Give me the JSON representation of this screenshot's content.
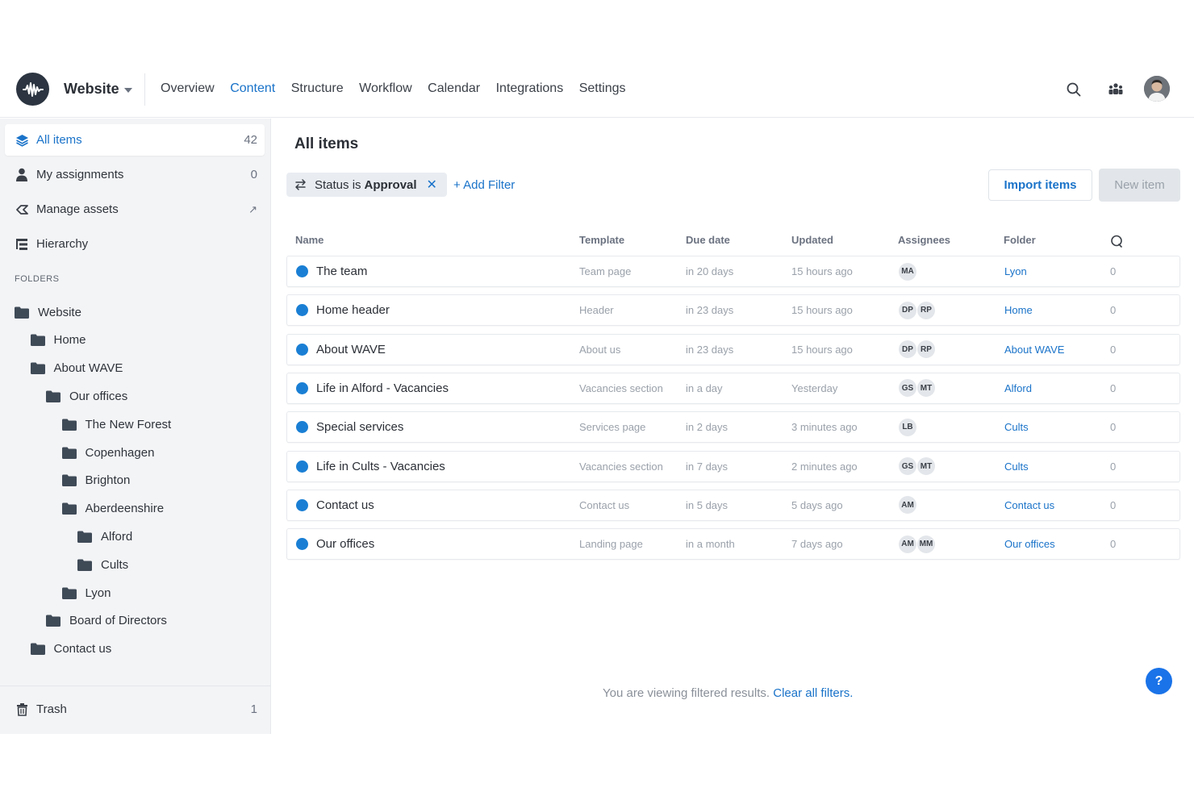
{
  "app": {
    "site_name": "Website",
    "nav": [
      "Overview",
      "Content",
      "Structure",
      "Workflow",
      "Calendar",
      "Integrations",
      "Settings"
    ],
    "active_nav": "Content"
  },
  "sidebar": {
    "items": [
      {
        "label": "All items",
        "count": "42",
        "icon": "layers-icon"
      },
      {
        "label": "My assignments",
        "count": "0",
        "icon": "user-icon"
      },
      {
        "label": "Manage assets",
        "count": "↗",
        "icon": "assets-icon"
      },
      {
        "label": "Hierarchy",
        "count": "",
        "icon": "hierarchy-icon"
      }
    ],
    "folders_label": "FOLDERS",
    "folders": [
      {
        "label": "Website",
        "level": 0
      },
      {
        "label": "Home",
        "level": 1
      },
      {
        "label": "About WAVE",
        "level": 1
      },
      {
        "label": "Our offices",
        "level": 2
      },
      {
        "label": "The New Forest",
        "level": 3
      },
      {
        "label": "Copenhagen",
        "level": 3
      },
      {
        "label": "Brighton",
        "level": 3
      },
      {
        "label": "Aberdeenshire",
        "level": 3
      },
      {
        "label": "Alford",
        "level": 4
      },
      {
        "label": "Cults",
        "level": 4
      },
      {
        "label": "Lyon",
        "level": 3
      },
      {
        "label": "Board of Directors",
        "level": 2
      },
      {
        "label": "Contact us",
        "level": 1
      }
    ],
    "trash": {
      "label": "Trash",
      "count": "1"
    }
  },
  "main": {
    "title": "All items",
    "filter": {
      "prefix": "Status is",
      "value": "Approval"
    },
    "add_filter": "+ Add Filter",
    "import_label": "Import items",
    "new_label": "New item",
    "columns": [
      "Name",
      "Template",
      "Due date",
      "Updated",
      "Assignees",
      "Folder"
    ],
    "rows": [
      {
        "name": "The team",
        "template": "Team page",
        "due": "in 20 days",
        "updated": "15 hours ago",
        "assignees": [
          "MA"
        ],
        "folder": "Lyon",
        "comments": "0"
      },
      {
        "name": "Home header",
        "template": "Header",
        "due": "in 23 days",
        "updated": "15 hours ago",
        "assignees": [
          "DP",
          "RP"
        ],
        "folder": "Home",
        "comments": "0"
      },
      {
        "name": "About WAVE",
        "template": "About us",
        "due": "in 23 days",
        "updated": "15 hours ago",
        "assignees": [
          "DP",
          "RP"
        ],
        "folder": "About WAVE",
        "comments": "0"
      },
      {
        "name": "Life in Alford - Vacancies",
        "template": "Vacancies section",
        "due": "in a day",
        "updated": "Yesterday",
        "assignees": [
          "GS",
          "MT"
        ],
        "folder": "Alford",
        "comments": "0"
      },
      {
        "name": "Special services",
        "template": "Services page",
        "due": "in 2 days",
        "updated": "3 minutes ago",
        "assignees": [
          "LB"
        ],
        "folder": "Cults",
        "comments": "0"
      },
      {
        "name": "Life in Cults - Vacancies",
        "template": "Vacancies section",
        "due": "in 7 days",
        "updated": "2 minutes ago",
        "assignees": [
          "GS",
          "MT"
        ],
        "folder": "Cults",
        "comments": "0"
      },
      {
        "name": "Contact us",
        "template": "Contact us",
        "due": "in 5 days",
        "updated": "5 days ago",
        "assignees": [
          "AM"
        ],
        "folder": "Contact us",
        "comments": "0"
      },
      {
        "name": "Our offices",
        "template": "Landing page",
        "due": "in a month",
        "updated": "7 days ago",
        "assignees": [
          "AM",
          "MM"
        ],
        "folder": "Our offices",
        "comments": "0"
      }
    ],
    "footer_text": "You are viewing filtered results.",
    "footer_link": "Clear all filters.",
    "help_label": "?"
  },
  "colors": {
    "accent": "#1a73c9",
    "status_dot": "#1a7fd4",
    "sidebar_bg": "#f3f4f6"
  }
}
